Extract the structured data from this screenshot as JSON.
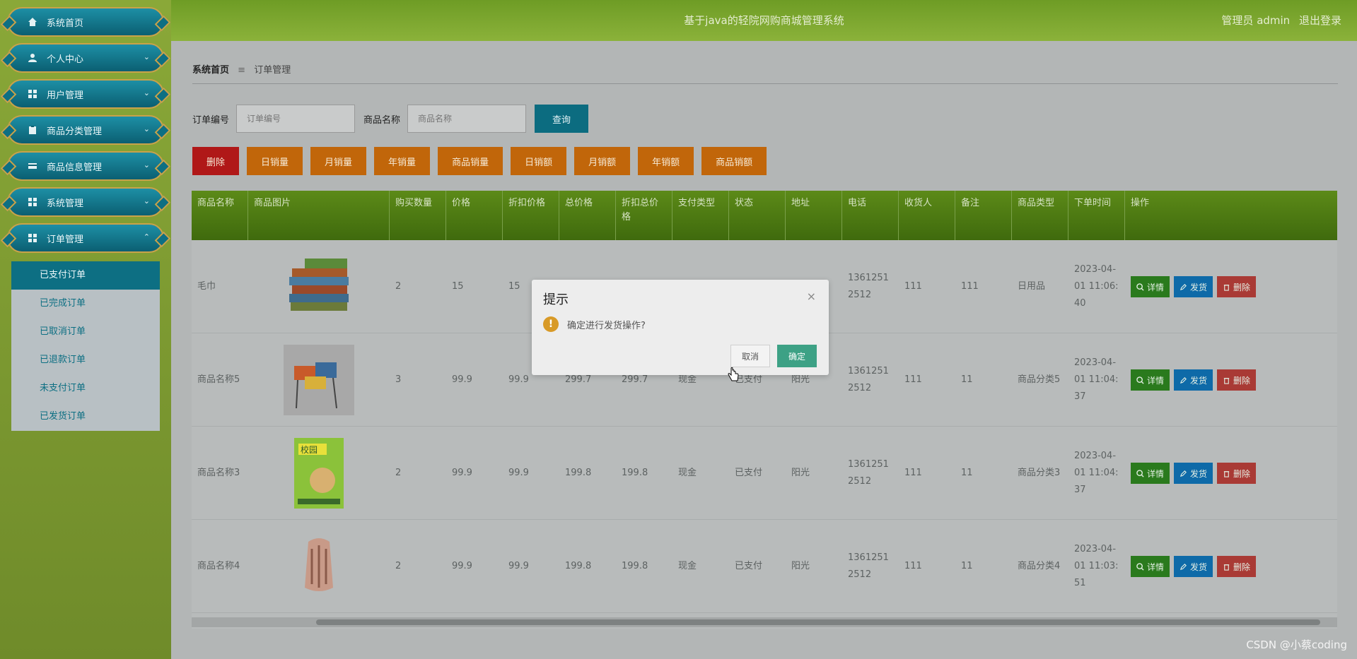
{
  "header": {
    "title": "基于java的轻院网购商城管理系统",
    "user_label": "管理员 admin",
    "logout": "退出登录"
  },
  "sidebar": {
    "items": [
      {
        "label": "系统首页",
        "icon": "home-icon"
      },
      {
        "label": "个人中心",
        "icon": "user-icon"
      },
      {
        "label": "用户管理",
        "icon": "grid-icon"
      },
      {
        "label": "商品分类管理",
        "icon": "clipboard-icon"
      },
      {
        "label": "商品信息管理",
        "icon": "card-icon"
      },
      {
        "label": "系统管理",
        "icon": "grid-icon"
      },
      {
        "label": "订单管理",
        "icon": "grid-icon"
      }
    ],
    "submenu": [
      {
        "label": "已支付订单",
        "active": true
      },
      {
        "label": "已完成订单"
      },
      {
        "label": "已取消订单"
      },
      {
        "label": "已退款订单"
      },
      {
        "label": "未支付订单"
      },
      {
        "label": "已发货订单"
      }
    ]
  },
  "breadcrumb": {
    "home": "系统首页",
    "sep": "≡",
    "current": "订单管理"
  },
  "search": {
    "order_no_label": "订单编号",
    "order_no_placeholder": "订单编号",
    "product_name_label": "商品名称",
    "product_name_placeholder": "商品名称",
    "query_button": "查询"
  },
  "actions": [
    "删除",
    "日销量",
    "月销量",
    "年销量",
    "商品销量",
    "日销额",
    "月销额",
    "年销额",
    "商品销额"
  ],
  "table": {
    "columns": [
      "商品名称",
      "商品图片",
      "购买数量",
      "价格",
      "折扣价格",
      "总价格",
      "折扣总价格",
      "支付类型",
      "状态",
      "地址",
      "电话",
      "收货人",
      "备注",
      "商品类型",
      "下单时间",
      "操作"
    ],
    "ops": {
      "detail": "详情",
      "ship": "发货",
      "delete": "删除"
    },
    "rows": [
      {
        "name": "毛巾",
        "image": "towels",
        "qty": "2",
        "price": "15",
        "discount_price": "15",
        "total": "",
        "discount_total": "",
        "pay_type": "",
        "status": "",
        "address": "",
        "phone": "13612512512",
        "receiver": "111",
        "note": "111",
        "type": "日用品",
        "time": "2023-04-01 11:06:40"
      },
      {
        "name": "商品名称5",
        "image": "chairs",
        "qty": "3",
        "price": "99.9",
        "discount_price": "99.9",
        "total": "299.7",
        "discount_total": "299.7",
        "pay_type": "现金",
        "status": "已支付",
        "address": "阳光",
        "phone": "13612512512",
        "receiver": "111",
        "note": "11",
        "type": "商品分类5",
        "time": "2023-04-01 11:04:37"
      },
      {
        "name": "商品名称3",
        "image": "book",
        "qty": "2",
        "price": "99.9",
        "discount_price": "99.9",
        "total": "199.8",
        "discount_total": "199.8",
        "pay_type": "现金",
        "status": "已支付",
        "address": "阳光",
        "phone": "13612512512",
        "receiver": "111",
        "note": "11",
        "type": "商品分类3",
        "time": "2023-04-01 11:04:37"
      },
      {
        "name": "商品名称4",
        "image": "backpack",
        "qty": "2",
        "price": "99.9",
        "discount_price": "99.9",
        "total": "199.8",
        "discount_total": "199.8",
        "pay_type": "现金",
        "status": "已支付",
        "address": "阳光",
        "phone": "13612512512",
        "receiver": "111",
        "note": "11",
        "type": "商品分类4",
        "time": "2023-04-01 11:03:51"
      }
    ]
  },
  "modal": {
    "title": "提示",
    "message": "确定进行发货操作?",
    "cancel": "取消",
    "ok": "确定",
    "close": "×",
    "warn_icon": "!"
  },
  "watermark": "CSDN @小蔡coding"
}
